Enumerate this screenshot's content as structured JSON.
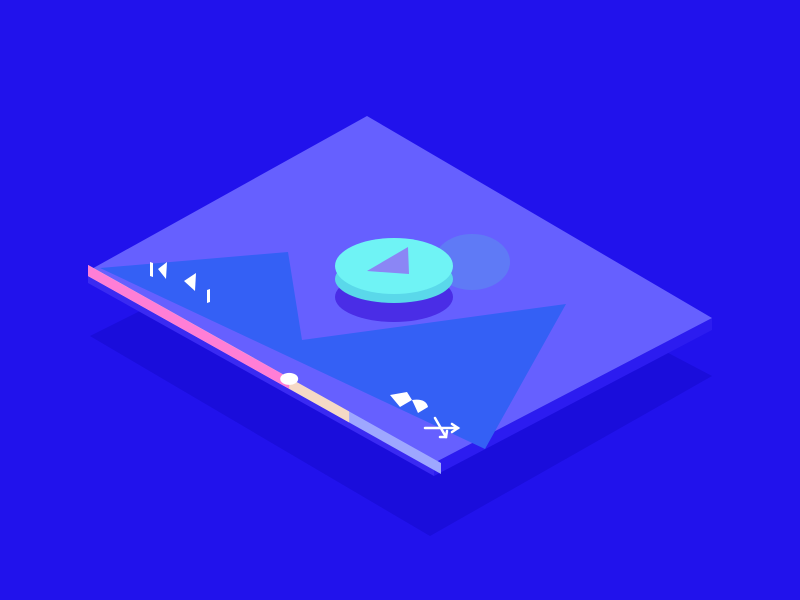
{
  "app": {
    "name": "",
    "title": ""
  },
  "player": {
    "state": "paused",
    "progress": 0.57,
    "buffered": 0.74,
    "controls": {
      "previous_icon": "skip-previous-icon",
      "next_icon": "skip-next-icon",
      "play_icon": "play-icon",
      "volume_icon": "volume-icon",
      "shuffle_icon": "shuffle-icon"
    }
  },
  "colors": {
    "background": "#2112EC",
    "screen_panel": "#6660FF",
    "mountain": "#3460F5",
    "progress_played": "#FF7ED6",
    "progress_buffered": "#F5D9C6",
    "progress_remaining": "#9EA7FF",
    "play_button": "#6FF3F5",
    "play_button_shadow": "#4A2DE6",
    "play_triangle": "#8B86F5",
    "sun": "#5F7AF6"
  }
}
